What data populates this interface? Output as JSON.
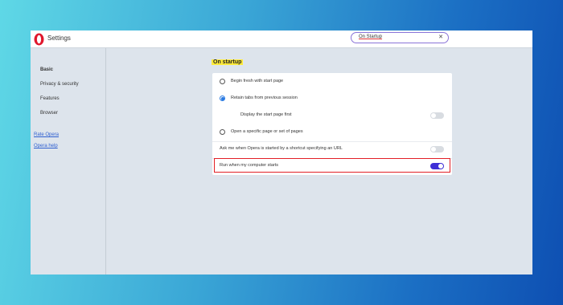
{
  "window": {
    "title": "Settings",
    "search": {
      "value": "On Startup",
      "clear_icon": "close-icon"
    }
  },
  "sidebar": {
    "items": [
      {
        "label": "Basic",
        "active": true
      },
      {
        "label": "Privacy & security",
        "active": false
      },
      {
        "label": "Features",
        "active": false
      },
      {
        "label": "Browser",
        "active": false
      }
    ],
    "links": [
      {
        "label": "Rate Opera"
      },
      {
        "label": "Opera help"
      }
    ]
  },
  "startup": {
    "section_title": "On startup",
    "options": {
      "begin_fresh": {
        "label": "Begin fresh with start page",
        "checked": false
      },
      "retain_tabs": {
        "label": "Retain tabs from previous session",
        "checked": true
      },
      "display_start_page": {
        "label": "Display the start page first",
        "enabled": false
      },
      "open_specific": {
        "label": "Open a specific page or set of pages",
        "checked": false
      },
      "ask_shortcut": {
        "label": "Ask me when Opera is started by a shortcut specifying an URL",
        "enabled": false
      },
      "run_on_start": {
        "label": "Run when my computer starts",
        "enabled": true
      }
    }
  },
  "colors": {
    "accent_toggle": "#3f2fd6",
    "radio_checked": "#2a7ae2",
    "highlight_border": "#e21f26",
    "section_highlight": "#ffeb3b",
    "brand_red": "#e0182d"
  }
}
